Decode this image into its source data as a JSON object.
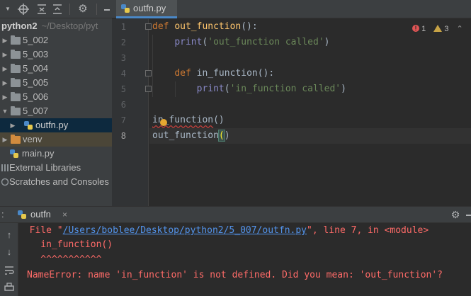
{
  "project_panel": {
    "tree": [
      {
        "label": "python2",
        "hint": "~/Desktop/pyt",
        "type": "root"
      },
      {
        "label": "5_002",
        "type": "folder"
      },
      {
        "label": "5_003",
        "type": "folder"
      },
      {
        "label": "5_004",
        "type": "folder"
      },
      {
        "label": "5_005",
        "type": "folder"
      },
      {
        "label": "5_006",
        "type": "folder"
      },
      {
        "label": "5_007",
        "type": "folder"
      },
      {
        "label": "outfn.py",
        "type": "file"
      },
      {
        "label": "venv",
        "type": "folder"
      },
      {
        "label": "main.py",
        "type": "file"
      },
      {
        "label": "External Libraries",
        "type": "libs"
      },
      {
        "label": "Scratches and Consoles",
        "type": "scratch"
      }
    ]
  },
  "editor": {
    "tab": {
      "label": "outfn.py",
      "close": "×"
    },
    "inspection": {
      "errors": "1",
      "warnings": "3"
    },
    "line_numbers": [
      "1",
      "2",
      "3",
      "4",
      "5",
      "6",
      "7",
      "8"
    ],
    "lines": {
      "l1": {
        "kw": "def",
        "name": "out_function",
        "rest": "():"
      },
      "l2": {
        "indent": "    ",
        "fn": "print",
        "open": "(",
        "str": "'out_function called'",
        "close": ")"
      },
      "l4": {
        "indent": "    ",
        "kw": "def",
        "name": "in_function",
        "rest": "():"
      },
      "l5": {
        "indent": "        ",
        "fn": "print",
        "open": "(",
        "str": "'in_function called'",
        "close": ")"
      },
      "l7": {
        "name": "in_function",
        "rest": "()"
      },
      "l8": {
        "name": "out_function",
        "open": "(",
        "close": ")"
      }
    }
  },
  "run_panel": {
    "label": ":",
    "tab": {
      "label": "outfn",
      "close": "×"
    },
    "console": {
      "file_prefix": "  File \"",
      "file_path": "/Users/boblee/Desktop/python2/5_007/outfn.py",
      "file_suffix": "\", line 7, in <module>",
      "code": "    in_function()",
      "carets": "    ^^^^^^^^^^^",
      "error": "NameError: name 'in_function' is not defined. Did you mean: 'out_function'?"
    }
  },
  "colors": {
    "keyword": "#cc7832",
    "function_name": "#ffc66d",
    "builtin": "#8888c6",
    "string": "#6a8759",
    "error_text": "#ff6b68",
    "link": "#5394ec",
    "selection": "#0d293e"
  },
  "icons": {
    "toolbar": [
      "dropdown-arrow-icon",
      "crosshair-icon",
      "collapse-all-icon",
      "expand-all-icon",
      "settings-icon",
      "minimize-icon"
    ],
    "run_sidebar": [
      "scroll-up-icon",
      "scroll-down-icon",
      "soft-wrap-icon",
      "print-icon",
      "delete-icon"
    ]
  }
}
